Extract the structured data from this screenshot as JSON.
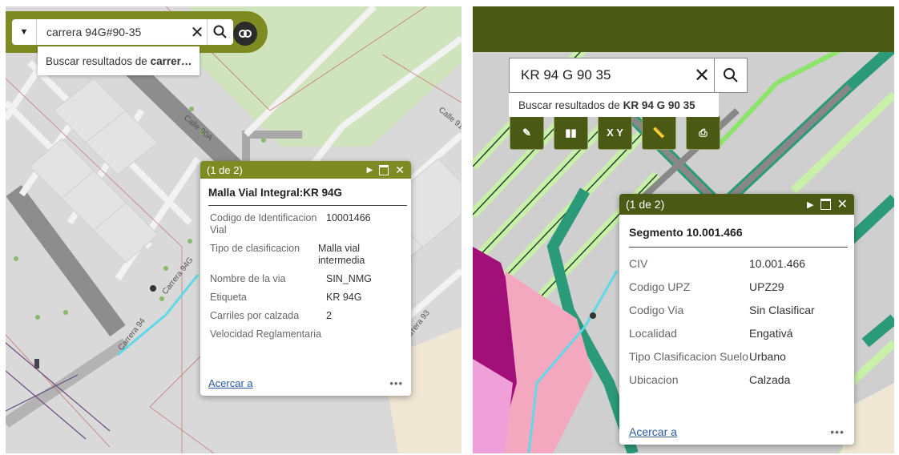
{
  "left_panel": {
    "search": {
      "value": "carrera 94G#90-35",
      "suggestion_prefix": "Buscar resultados de ",
      "suggestion_term": "carrer…"
    },
    "map_labels": {
      "street_calle_90a": "Calle 90A",
      "street_calle_91": "Calle 91",
      "street_carrera_94g": "Carrera 94G",
      "street_carrera_94": "Carrera 94",
      "street_carrera_93": "Carrera 93"
    },
    "popup": {
      "counter": "(1 de 2)",
      "title": "Malla Vial Integral:KR 94G",
      "fields": [
        {
          "name": "Codigo de Identificacion Vial",
          "value": "10001466"
        },
        {
          "name": "Tipo de clasificacion",
          "value": "Malla vial intermedia"
        },
        {
          "name": "Nombre de la via",
          "value": "SIN_NMG"
        },
        {
          "name": "Etiqueta",
          "value": "KR 94G"
        },
        {
          "name": "Carriles por calzada",
          "value": "2"
        },
        {
          "name": "Velocidad Reglamentaria",
          "value": ""
        }
      ],
      "zoom_link": "Acercar a",
      "more": "•••"
    }
  },
  "right_panel": {
    "search": {
      "value": "KR 94 G 90 35",
      "suggestion_prefix": "Buscar resultados de ",
      "suggestion_term": "KR 94 G 90 35"
    },
    "tools": [
      {
        "icon": "draw-icon",
        "label": ""
      },
      {
        "icon": "layers-icon",
        "label": ""
      },
      {
        "icon": "xy-icon",
        "label": "X Y"
      },
      {
        "icon": "measure-icon",
        "label": ""
      },
      {
        "icon": "print-icon",
        "label": ""
      }
    ],
    "popup": {
      "counter": "(1 de 2)",
      "title": "Segmento 10.001.466",
      "fields": [
        {
          "name": "CIV",
          "value": "10.001.466"
        },
        {
          "name": "Codigo UPZ",
          "value": "UPZ29"
        },
        {
          "name": "Codigo Via",
          "value": "Sin Clasificar"
        },
        {
          "name": "Localidad",
          "value": "Engativá"
        },
        {
          "name": "Tipo Clasificacion Suelo",
          "value": "Urbano"
        },
        {
          "name": "Ubicacion",
          "value": "Calzada"
        }
      ],
      "zoom_link": "Acercar a",
      "more": "•••"
    }
  },
  "colors": {
    "brand_olive": "#7e8a22",
    "brand_dark_olive": "#4a5a14",
    "road_green": "#2a9a78",
    "highlight_cyan": "#5fd8e8"
  }
}
